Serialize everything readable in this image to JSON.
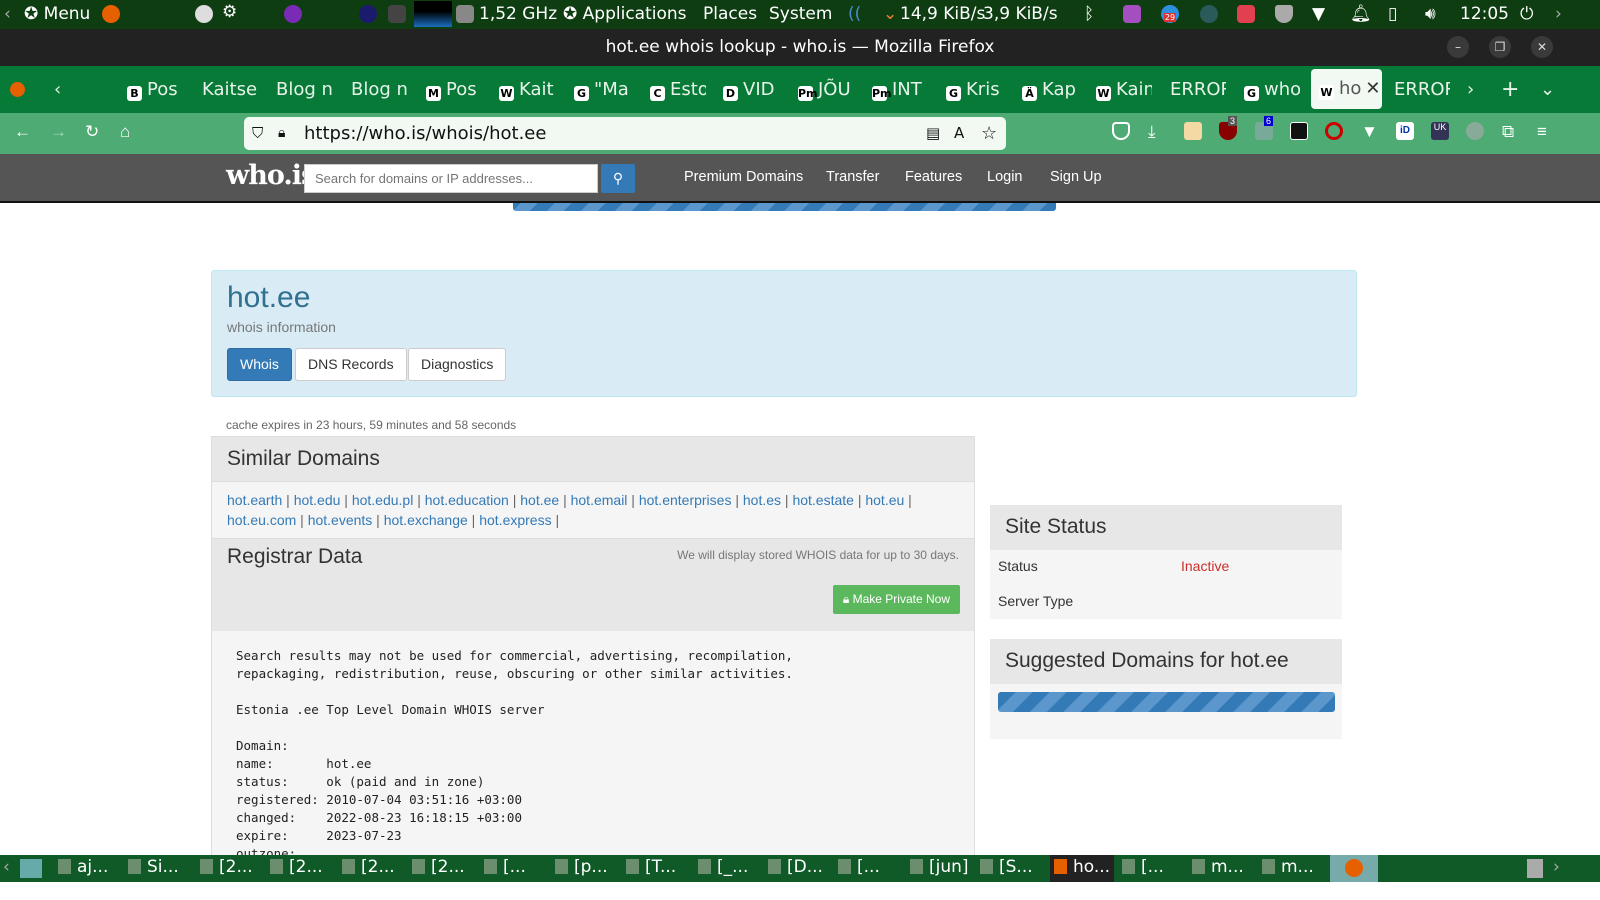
{
  "panel": {
    "menu": "Menu",
    "cpu": "1,52 GHz",
    "applications": "Applications",
    "places": "Places",
    "system": "System",
    "down": "14,9 KiB/s",
    "up": "3,9 KiB/s",
    "clock": "12:05",
    "badge_calendar": "29"
  },
  "window": {
    "title": "hot.ee whois lookup - who.is — Mozilla Firefox"
  },
  "tabs": [
    {
      "label": "Pos",
      "icon": "B"
    },
    {
      "label": "Kaitse"
    },
    {
      "label": "Blog n"
    },
    {
      "label": "Blog n"
    },
    {
      "label": "Pos",
      "icon": "M"
    },
    {
      "label": "Kait",
      "icon": "W"
    },
    {
      "label": "\"Ma",
      "icon": "G"
    },
    {
      "label": "Esto",
      "icon": "C"
    },
    {
      "label": "VID",
      "icon": "D"
    },
    {
      "label": "JÕU",
      "icon": "Pm"
    },
    {
      "label": "INT",
      "icon": "Pm"
    },
    {
      "label": "Kris",
      "icon": "G"
    },
    {
      "label": "Kap",
      "icon": "Ä"
    },
    {
      "label": "Kain",
      "icon": "W"
    },
    {
      "label": "ERROR"
    },
    {
      "label": "who",
      "icon": "G"
    },
    {
      "label": "ho",
      "icon": "W",
      "active": true
    },
    {
      "label": "ERROR"
    }
  ],
  "address": {
    "url": "https://who.is/whois/hot.ee"
  },
  "toolbar_badges": {
    "ublock": "3",
    "ext6": "6",
    "uk": "UK"
  },
  "site": {
    "logo": "who.is",
    "search_placeholder": "Search for domains or IP addresses...",
    "menu": [
      "Premium Domains",
      "Transfer",
      "Features",
      "Login",
      "Sign Up"
    ]
  },
  "hero": {
    "domain": "hot.ee",
    "subtitle": "whois information",
    "tabs": [
      "Whois",
      "DNS Records",
      "Diagnostics"
    ]
  },
  "cache": "cache expires in 23 hours, 59 minutes and 58 seconds",
  "similar": {
    "title": "Similar Domains",
    "domains": [
      "hot.earth",
      "hot.edu",
      "hot.edu.pl",
      "hot.education",
      "hot.ee",
      "hot.email",
      "hot.enterprises",
      "hot.es",
      "hot.estate",
      "hot.eu",
      "hot.eu.com",
      "hot.events",
      "hot.exchange",
      "hot.express"
    ]
  },
  "registrar": {
    "title": "Registrar Data",
    "note": "We will display stored WHOIS data for up to 30 days.",
    "private_button": "Make Private Now",
    "raw": "Search results may not be used for commercial, advertising, recompilation,\nrepackaging, redistribution, reuse, obscuring or other similar activities.\n\nEstonia .ee Top Level Domain WHOIS server\n\nDomain:\nname:       hot.ee\nstatus:     ok (paid and in zone)\nregistered: 2010-07-04 03:51:16 +03:00\nchanged:    2022-08-23 16:18:15 +03:00\nexpire:     2023-07-23\noutzone:"
  },
  "site_status": {
    "title": "Site Status",
    "status_label": "Status",
    "status_value": "Inactive",
    "server_label": "Server Type",
    "status_color": "#c9302c"
  },
  "suggested": {
    "title": "Suggested Domains for hot.ee"
  },
  "taskbar": [
    "aj...",
    "Si...",
    "[2...",
    "[2...",
    "[2...",
    "[2...",
    "[...",
    "[p...",
    "[T...",
    "[_...",
    "[D...",
    "[...",
    "[jun]",
    "[S...",
    "ho...",
    "[...",
    "m...",
    "m..."
  ]
}
